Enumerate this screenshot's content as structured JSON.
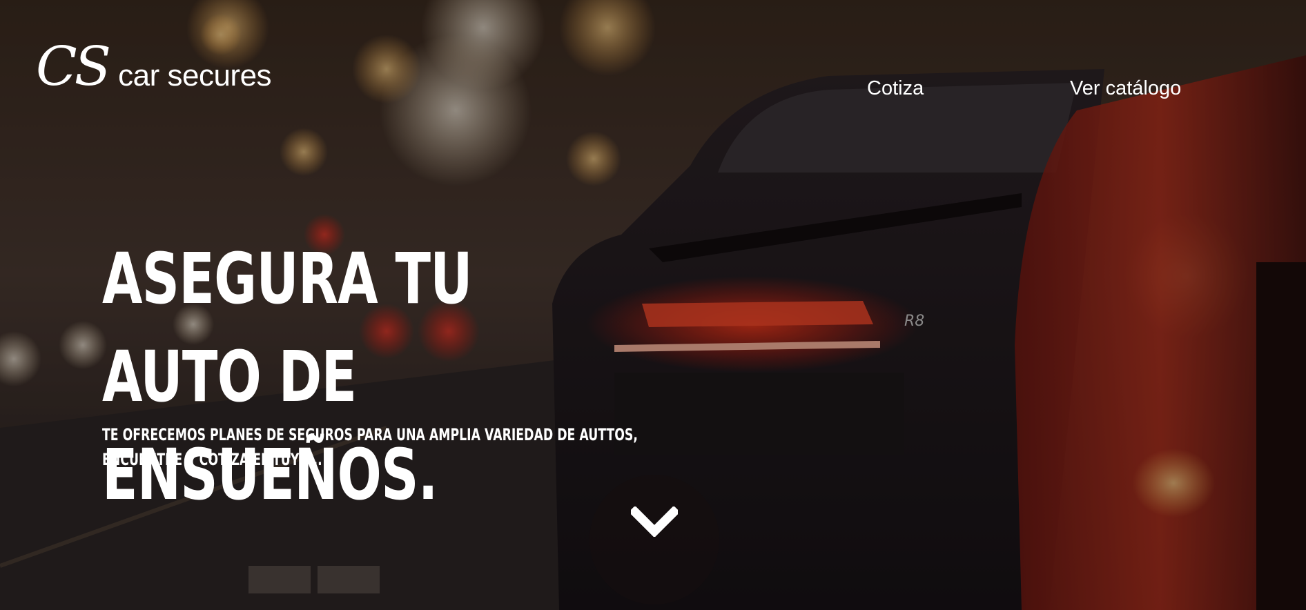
{
  "brand": {
    "logo_mark": "CS",
    "name": "car secures"
  },
  "nav": {
    "items": [
      {
        "label": "Cotiza"
      },
      {
        "label": "Ver catálogo"
      }
    ]
  },
  "hero": {
    "headline": "ASEGURA TU AUTO DE\nENSUEÑOS.",
    "subtext": "TE OFRECEMOS PLANES DE SEGUROS PARA UNA AMPLIA VARIEDAD DE AUTTOS, ENCUENTRE Y COTIZA EL TUYO...",
    "background_image": "red sports car rear at night street",
    "scroll_icon": "chevron-down-icon"
  },
  "colors": {
    "text": "#ffffff",
    "taillight": "#ff2a1a",
    "overlay": "#0a0606"
  }
}
